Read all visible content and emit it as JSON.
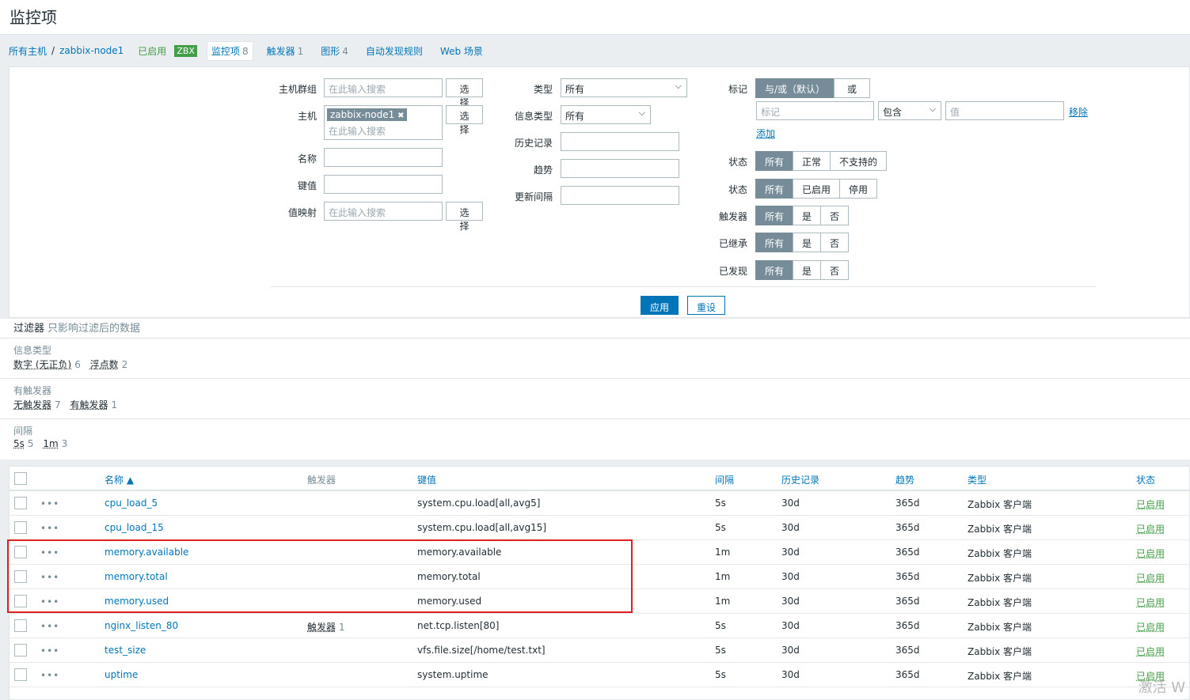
{
  "page": {
    "title": "监控项"
  },
  "breadcrumb": {
    "all_hosts": "所有主机",
    "separator": "/",
    "host": "zabbix-node1",
    "enabled": "已启用",
    "zbx": "ZBX",
    "tabs": [
      {
        "label": "监控项",
        "count": "8"
      },
      {
        "label": "触发器",
        "count": "1"
      },
      {
        "label": "图形",
        "count": "4"
      },
      {
        "label": "自动发现规则",
        "count": ""
      },
      {
        "label": "Web 场景",
        "count": ""
      }
    ]
  },
  "filter": {
    "host_group_label": "主机群组",
    "host_group_placeholder": "在此输入搜索",
    "select_label": "选择",
    "host_label": "主机",
    "host_chip": "zabbix-node1",
    "chip_remove": "✖",
    "host_placeholder": "在此输入搜索",
    "name_label": "名称",
    "key_label": "键值",
    "valuemap_label": "值映射",
    "valuemap_placeholder": "在此输入搜索",
    "type_label": "类型",
    "type_value": "所有",
    "info_type_label": "信息类型",
    "info_type_value": "所有",
    "history_label": "历史记录",
    "trends_label": "趋势",
    "interval_label": "更新间隔",
    "tags_label": "标记",
    "tag_andor": "与/或（默认）",
    "tag_or": "或",
    "tag_placeholder": "标记",
    "tag_op": "包含",
    "tag_value_placeholder": "值",
    "tag_remove": "移除",
    "tag_add": "添加",
    "state_label": "状态",
    "state_opts": [
      "所有",
      "正常",
      "不支持的"
    ],
    "status_label": "状态",
    "status_opts": [
      "所有",
      "已启用",
      "停用"
    ],
    "triggers_label": "触发器",
    "inherited_label": "已继承",
    "discovered_label": "已发现",
    "yes_no_opts": [
      "所有",
      "是",
      "否"
    ],
    "apply": "应用",
    "reset": "重设"
  },
  "subfilter": {
    "title": "过滤器",
    "note": "只影响过滤后的数据",
    "sections": [
      {
        "header": "信息类型",
        "values": [
          {
            "label": "数字 (无正负)",
            "count": "6"
          },
          {
            "label": "浮点数",
            "count": "2"
          }
        ]
      },
      {
        "header": "有触发器",
        "values": [
          {
            "label": "无触发器",
            "count": "7"
          },
          {
            "label": "有触发器",
            "count": "1"
          }
        ]
      },
      {
        "header": "间隔",
        "values": [
          {
            "label": "5s",
            "count": "5"
          },
          {
            "label": "1m",
            "count": "3"
          }
        ]
      }
    ]
  },
  "table": {
    "headers": {
      "name": "名称 ▲",
      "triggers": "触发器",
      "key": "键值",
      "interval": "间隔",
      "history": "历史记录",
      "trends": "趋势",
      "type": "类型",
      "status": "状态"
    },
    "rows": [
      {
        "name": "cpu_load_5",
        "triggers": "",
        "trig_count": "",
        "key": "system.cpu.load[all,avg5]",
        "interval": "5s",
        "history": "30d",
        "trends": "365d",
        "type": "Zabbix 客户端",
        "status": "已启用"
      },
      {
        "name": "cpu_load_15",
        "triggers": "",
        "trig_count": "",
        "key": "system.cpu.load[all,avg15]",
        "interval": "5s",
        "history": "30d",
        "trends": "365d",
        "type": "Zabbix 客户端",
        "status": "已启用"
      },
      {
        "name": "memory.available",
        "triggers": "",
        "trig_count": "",
        "key": "memory.available",
        "interval": "1m",
        "history": "30d",
        "trends": "365d",
        "type": "Zabbix 客户端",
        "status": "已启用"
      },
      {
        "name": "memory.total",
        "triggers": "",
        "trig_count": "",
        "key": "memory.total",
        "interval": "1m",
        "history": "30d",
        "trends": "365d",
        "type": "Zabbix 客户端",
        "status": "已启用"
      },
      {
        "name": "memory.used",
        "triggers": "",
        "trig_count": "",
        "key": "memory.used",
        "interval": "1m",
        "history": "30d",
        "trends": "365d",
        "type": "Zabbix 客户端",
        "status": "已启用"
      },
      {
        "name": "nginx_listen_80",
        "triggers": "触发器",
        "trig_count": "1",
        "key": "net.tcp.listen[80]",
        "interval": "5s",
        "history": "30d",
        "trends": "365d",
        "type": "Zabbix 客户端",
        "status": "已启用"
      },
      {
        "name": "test_size",
        "triggers": "",
        "trig_count": "",
        "key": "vfs.file.size[/home/test.txt]",
        "interval": "5s",
        "history": "30d",
        "trends": "365d",
        "type": "Zabbix 客户端",
        "status": "已启用"
      },
      {
        "name": "uptime",
        "triggers": "",
        "trig_count": "",
        "key": "system.uptime",
        "interval": "5s",
        "history": "30d",
        "trends": "365d",
        "type": "Zabbix 客户端",
        "status": "已启用"
      }
    ],
    "row_menu": "•••"
  },
  "watermark": "激活 W"
}
